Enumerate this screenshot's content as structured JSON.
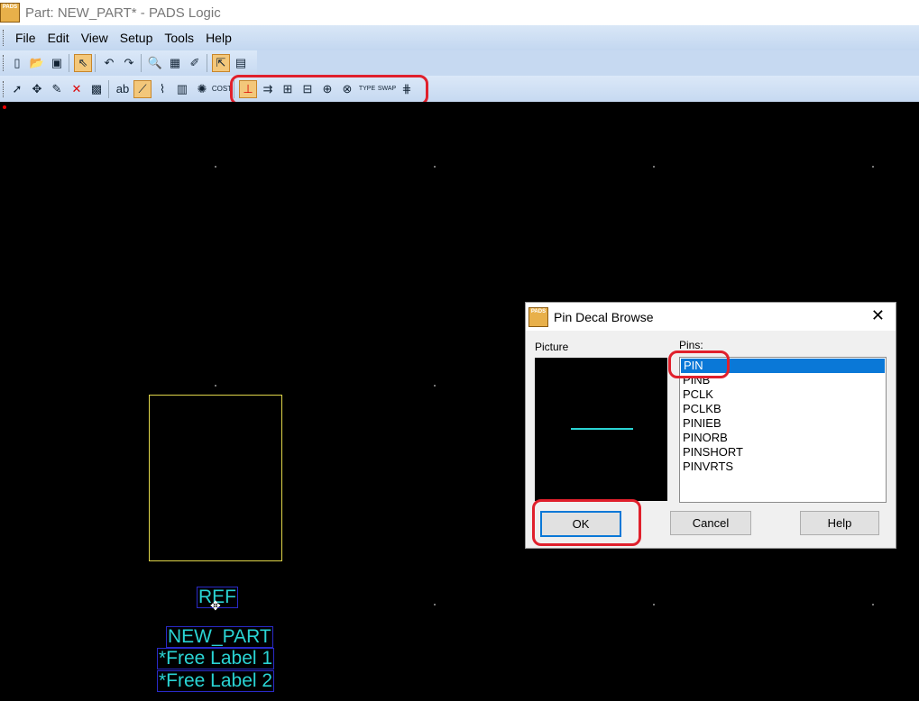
{
  "window": {
    "app_icon_text": "PADS",
    "title": "Part: NEW_PART* - PADS Logic"
  },
  "menu": [
    "File",
    "Edit",
    "View",
    "Setup",
    "Tools",
    "Help"
  ],
  "toolbar1": [
    "new-icon",
    "open-icon",
    "save-icon",
    "select-icon",
    "undo-icon",
    "redo-icon",
    "find-icon",
    "properties-icon",
    "eraser-icon",
    "decal-editor-icon",
    "window-icon"
  ],
  "toolbar2": [
    "arrow-select-icon",
    "move-icon",
    "pen-icon",
    "delete-icon",
    "part-properties-icon",
    "text-icon",
    "line-icon",
    "shape-icon",
    "terminal-icon",
    "spark-icon",
    "cost-icon",
    "add-pin-icon",
    "add-terminal-icon",
    "pin-bus-icon",
    "swap-pins-icon",
    "pin-number-icon",
    "pin-name-icon",
    "pin-type-icon",
    "pin-swap-icon",
    "pin-sequence-icon"
  ],
  "canvas": {
    "part_labels": [
      "REF",
      "NEW_PART",
      "*Free Label 1",
      "*Free Label 2"
    ]
  },
  "dialog": {
    "icon_text": "PADS",
    "title": "Pin Decal Browse",
    "picture_label": "Picture",
    "pins_label": "Pins:",
    "pins": [
      "PIN",
      "PINB",
      "PCLK",
      "PCLKB",
      "PINIEB",
      "PINORB",
      "PINSHORT",
      "PINVRTS"
    ],
    "selected_pin": "PIN",
    "ok_label": "OK",
    "cancel_label": "Cancel",
    "help_label": "Help"
  },
  "colors": {
    "canvas": "#000000",
    "part_outline": "#e0d64a",
    "label_text": "#2ad4d4",
    "label_border": "#2a2ac8",
    "highlight": "#e0202c",
    "selection": "#0a78d7"
  }
}
